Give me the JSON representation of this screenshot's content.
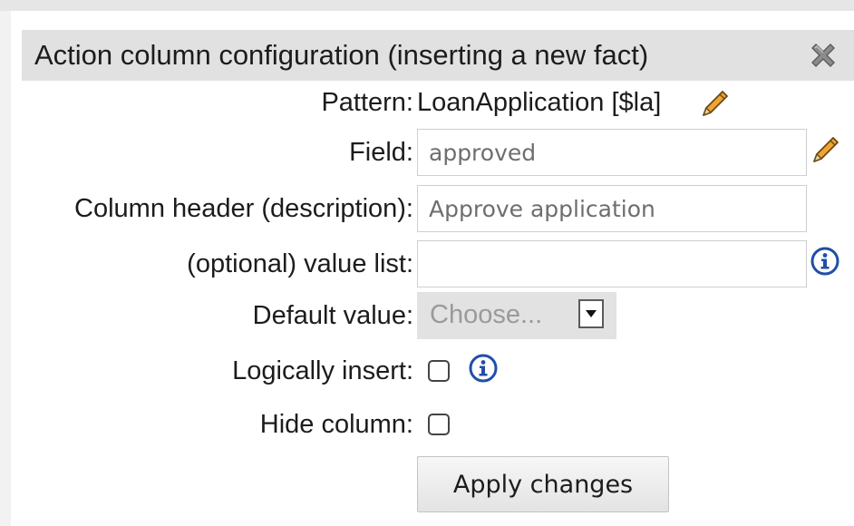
{
  "dialog": {
    "title": "Action column configuration (inserting a new fact)",
    "close_icon": "close-x-icon"
  },
  "pattern": {
    "label": "Pattern:",
    "value": "LoanApplication [$la]",
    "edit_icon": "pencil-icon"
  },
  "field": {
    "label": "Field:",
    "value": "approved",
    "edit_icon": "pencil-icon"
  },
  "column_header": {
    "label": "Column header (description):",
    "value": "Approve application"
  },
  "value_list": {
    "label": "(optional) value list:",
    "value": "",
    "info_icon": "info-icon"
  },
  "default_value": {
    "label": "Default value:",
    "selected": "Choose..."
  },
  "logically_insert": {
    "label": "Logically insert:",
    "checked": false,
    "info_icon": "info-icon"
  },
  "hide_column": {
    "label": "Hide column:",
    "checked": false
  },
  "apply_button": {
    "label": "Apply changes"
  },
  "colors": {
    "title_bar": "#e1e1e1",
    "info_blue": "#1f4fa8",
    "pencil_orange": "#e38c1c"
  }
}
